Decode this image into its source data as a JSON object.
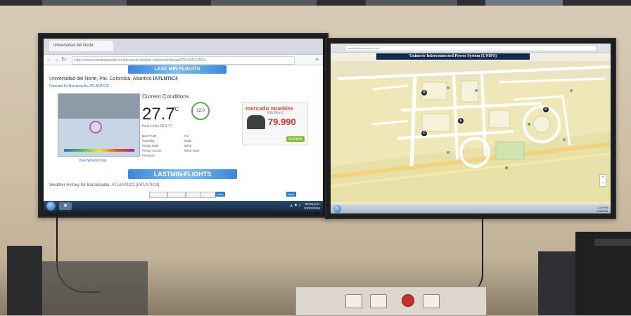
{
  "left_screen": {
    "browser": {
      "tab_title": "Universidad del Norte",
      "url": "https://www.wunderground.com/personal-weather-station/dashboard?ID=IATLNTIC4",
      "top_banner": "LAST MIN FLIGHTS"
    },
    "weather": {
      "location_prefix": "Universidad del Norte, Pto. Colombia, Atlantico",
      "station_id": "IATLNTIC4",
      "subline": "Forecast for Barranquilla, ATLANTICO",
      "current_conditions_label": "Current Conditions",
      "temperature": "27.7",
      "temperature_unit": "°C",
      "gauge_value": "12.0",
      "feels_like": "Heat Index 28.3 °C",
      "view_map_link": "View Wundermap",
      "stats": [
        "Dew Point",
        "Humidity",
        "Precip Rate",
        "Precip Accum",
        "Pressure",
        "UV",
        "Solar",
        "Wind",
        "Wind Gust"
      ]
    },
    "ad": {
      "brand": "mercado muebles",
      "promo": "Silla Blend",
      "price": "79.990",
      "button": "Comprar"
    },
    "lastmin_banner": "LASTMIN-FLIGHTS",
    "history": {
      "title": "Weather History for Barranquilla, ATLANTICO [IATLNTIC4]",
      "view_button": "View",
      "next_button": "Next"
    },
    "taskbar": {
      "clock_time": "02:25 p.m.",
      "clock_date": "02/03/2016"
    }
  },
  "right_screen": {
    "url": "localhost/unips/index.html",
    "title": "Uninorte Interconnected Power System (UNIPS)",
    "map": {
      "marker_labels": [
        "B",
        "C",
        "D",
        "E"
      ]
    },
    "taskbar": {
      "clock_time": "2:25 PM",
      "clock_date": "2/3/2016"
    }
  }
}
